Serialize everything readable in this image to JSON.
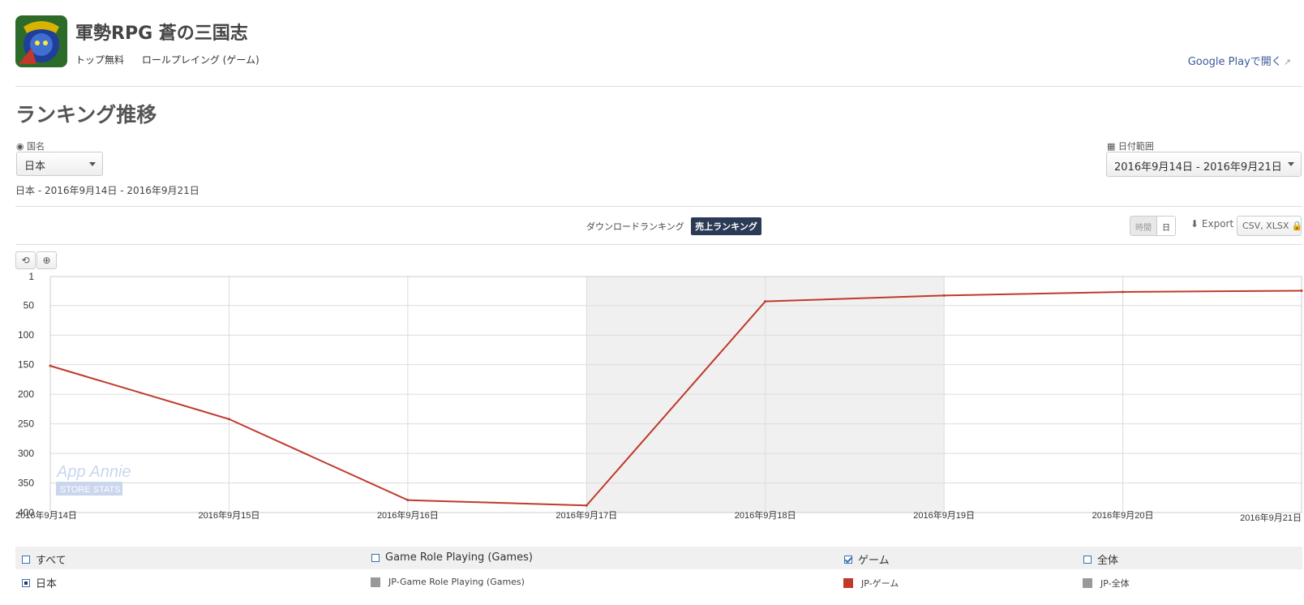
{
  "app": {
    "title": "軍勢RPG 蒼の三国志",
    "meta": [
      "トップ無料",
      "ロールプレイング (ゲーム)"
    ],
    "store_link": "Google Playで開く"
  },
  "section_title": "ランキング推移",
  "filters": {
    "country_label": "国名",
    "country_value": "日本",
    "date_label": "日付範囲",
    "date_value": "2016年9月14日 - 2016年9月21日",
    "summary": "日本 - 2016年9月14日 - 2016年9月21日"
  },
  "ranking_tabs": [
    {
      "label": "ダウンロードランキング",
      "active": false
    },
    {
      "label": "売上ランキング",
      "active": true
    }
  ],
  "granularity": [
    {
      "label": "時間",
      "active": false
    },
    {
      "label": "日",
      "active": true
    }
  ],
  "export": {
    "label": "Export",
    "format_button": "CSV, XLSX"
  },
  "tools": {
    "reset": "⟲",
    "zoom": "⊕"
  },
  "watermark": {
    "line1": "App Annie",
    "line2": "STORE STATS"
  },
  "colors": {
    "series": "#c0392b",
    "grey": "#999999",
    "accent": "#2b3a55"
  },
  "chart_data": {
    "type": "line",
    "x": [
      "2016年9月14日",
      "2016年9月15日",
      "2016年9月16日",
      "2016年9月17日",
      "2016年9月18日",
      "2016年9月19日",
      "2016年9月20日",
      "2016年9月21日"
    ],
    "series": [
      {
        "name": "JP-ゲーム",
        "values": [
          152,
          242,
          379,
          388,
          43,
          33,
          27,
          25
        ]
      }
    ],
    "y_ticks": [
      1,
      50,
      100,
      150,
      200,
      250,
      300,
      350,
      400
    ],
    "ylim": [
      1,
      400
    ],
    "y_reversed": true,
    "grid": true,
    "shaded_x_ranges": [
      [
        "2016年9月17日",
        "2016年9月19日"
      ]
    ]
  },
  "legend": {
    "headers": [
      {
        "label": "すべて",
        "checked": false
      },
      {
        "label": "Game Role Playing (Games)",
        "checked": false
      },
      {
        "label": "ゲーム",
        "checked": true
      },
      {
        "label": "全体",
        "checked": false
      }
    ],
    "row": {
      "country": "日本",
      "entries": [
        {
          "label": "JP-Game Role Playing (Games)",
          "color": "#999999"
        },
        {
          "label": "JP-ゲーム",
          "color": "#c0392b"
        },
        {
          "label": "JP-全体",
          "color": "#999999"
        }
      ]
    }
  }
}
